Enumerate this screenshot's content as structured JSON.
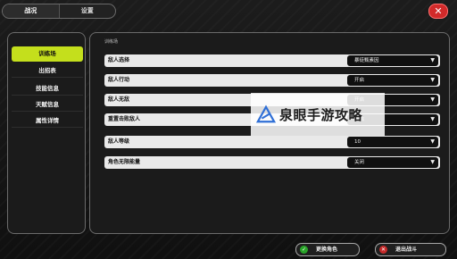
{
  "tabs": [
    {
      "label": "战况"
    },
    {
      "label": "设置"
    }
  ],
  "close_glyph": "✕",
  "sidebar": {
    "items": [
      {
        "label": "训练场",
        "active": true
      },
      {
        "label": "出招表"
      },
      {
        "label": "技能信息"
      },
      {
        "label": "天赋信息"
      },
      {
        "label": "属性详情"
      }
    ]
  },
  "main": {
    "section_title": "训练场",
    "rows": [
      {
        "label": "敌人选择",
        "value": "暴徒甄素因"
      },
      {
        "label": "敌人行动",
        "value": "开启"
      },
      {
        "label": "敌人无敌",
        "value": "开启"
      },
      {
        "label": "重置击败敌人",
        "value": "开启"
      },
      {
        "label": "敌人等级",
        "value": "10"
      },
      {
        "label": "角色无限能量",
        "value": "关闭"
      }
    ]
  },
  "watermark": {
    "text": "泉眼手游攻略"
  },
  "bottom": {
    "switch_label": "更换角色",
    "exit_label": "退出战斗"
  },
  "colors": {
    "accent": "#c4df1c",
    "close": "#d22a2a",
    "switch_icon": "#2aa52a",
    "exit_icon": "#c62a2a"
  }
}
